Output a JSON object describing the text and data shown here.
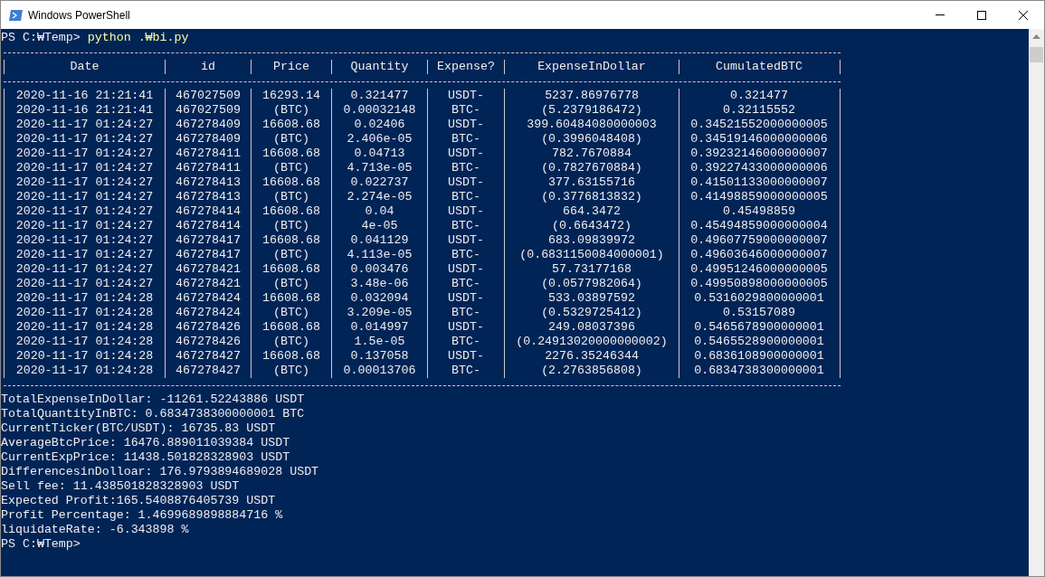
{
  "window": {
    "title": "Windows PowerShell"
  },
  "command_line": {
    "prompt": "PS C:₩Temp>",
    "command": "python .₩bi.py"
  },
  "table": {
    "columns": [
      "Date",
      "id",
      "Price",
      "Quantity",
      "Expense?",
      "ExpenseInDollar",
      "CumulatedBTC"
    ],
    "rows": [
      [
        "2020-11-16 21:21:41",
        "467027509",
        "16293.14",
        "0.321477",
        "USDT-",
        "5237.86976778",
        "0.321477"
      ],
      [
        "2020-11-16 21:21:41",
        "467027509",
        "(BTC)",
        "0.00032148",
        "BTC-",
        "(5.2379186472)",
        "0.32115552"
      ],
      [
        "2020-11-17 01:24:27",
        "467278409",
        "16608.68",
        "0.02406",
        "USDT-",
        "399.60484080000003",
        "0.34521552000000005"
      ],
      [
        "2020-11-17 01:24:27",
        "467278409",
        "(BTC)",
        "2.406e-05",
        "BTC-",
        "(0.3996048408)",
        "0.34519146000000006"
      ],
      [
        "2020-11-17 01:24:27",
        "467278411",
        "16608.68",
        "0.04713",
        "USDT-",
        "782.7670884",
        "0.39232146000000007"
      ],
      [
        "2020-11-17 01:24:27",
        "467278411",
        "(BTC)",
        "4.713e-05",
        "BTC-",
        "(0.7827670884)",
        "0.39227433000000006"
      ],
      [
        "2020-11-17 01:24:27",
        "467278413",
        "16608.68",
        "0.022737",
        "USDT-",
        "377.63155716",
        "0.41501133000000007"
      ],
      [
        "2020-11-17 01:24:27",
        "467278413",
        "(BTC)",
        "2.274e-05",
        "BTC-",
        "(0.3776813832)",
        "0.41498859000000005"
      ],
      [
        "2020-11-17 01:24:27",
        "467278414",
        "16608.68",
        "0.04",
        "USDT-",
        "664.3472",
        "0.45498859"
      ],
      [
        "2020-11-17 01:24:27",
        "467278414",
        "(BTC)",
        "4e-05",
        "BTC-",
        "(0.6643472)",
        "0.45494859000000004"
      ],
      [
        "2020-11-17 01:24:27",
        "467278417",
        "16608.68",
        "0.041129",
        "USDT-",
        "683.09839972",
        "0.49607759000000007"
      ],
      [
        "2020-11-17 01:24:27",
        "467278417",
        "(BTC)",
        "4.113e-05",
        "BTC-",
        "(0.6831150084000001)",
        "0.49603646000000007"
      ],
      [
        "2020-11-17 01:24:27",
        "467278421",
        "16608.68",
        "0.003476",
        "USDT-",
        "57.73177168",
        "0.49951246000000005"
      ],
      [
        "2020-11-17 01:24:27",
        "467278421",
        "(BTC)",
        "3.48e-06",
        "BTC-",
        "(0.0577982064)",
        "0.49950898000000005"
      ],
      [
        "2020-11-17 01:24:28",
        "467278424",
        "16608.68",
        "0.032094",
        "USDT-",
        "533.03897592",
        "0.5316029800000001"
      ],
      [
        "2020-11-17 01:24:28",
        "467278424",
        "(BTC)",
        "3.209e-05",
        "BTC-",
        "(0.5329725412)",
        "0.53157089"
      ],
      [
        "2020-11-17 01:24:28",
        "467278426",
        "16608.68",
        "0.014997",
        "USDT-",
        "249.08037396",
        "0.5465678900000001"
      ],
      [
        "2020-11-17 01:24:28",
        "467278426",
        "(BTC)",
        "1.5e-05",
        "BTC-",
        "(0.24913020000000002)",
        "0.5465528900000001"
      ],
      [
        "2020-11-17 01:24:28",
        "467278427",
        "16608.68",
        "0.137058",
        "USDT-",
        "2276.35246344",
        "0.6836108900000001"
      ],
      [
        "2020-11-17 01:24:28",
        "467278427",
        "(BTC)",
        "0.00013706",
        "BTC-",
        "(2.2763856808)",
        "0.6834738300000001"
      ]
    ]
  },
  "summary_lines": [
    "TotalExpenseInDollar: -11261.52243886 USDT",
    "TotalQuantityInBTC: 0.6834738300000001 BTC",
    "CurrentTicker(BTC/USDT): 16735.83 USDT",
    "AverageBtcPrice: 16476.889011039384 USDT",
    "CurrentExpPrice: 11438.501828328903 USDT",
    "DifferencesinDolloar: 176.9793894689028 USDT",
    "Sell fee: 11.438501828328903 USDT",
    "Expected Profit:165.5408876405739 USDT",
    "Profit Percentage: 1.4699689898884716 %",
    "liquidateRate: -6.343898 %"
  ],
  "final_prompt": "PS C:₩Temp>"
}
